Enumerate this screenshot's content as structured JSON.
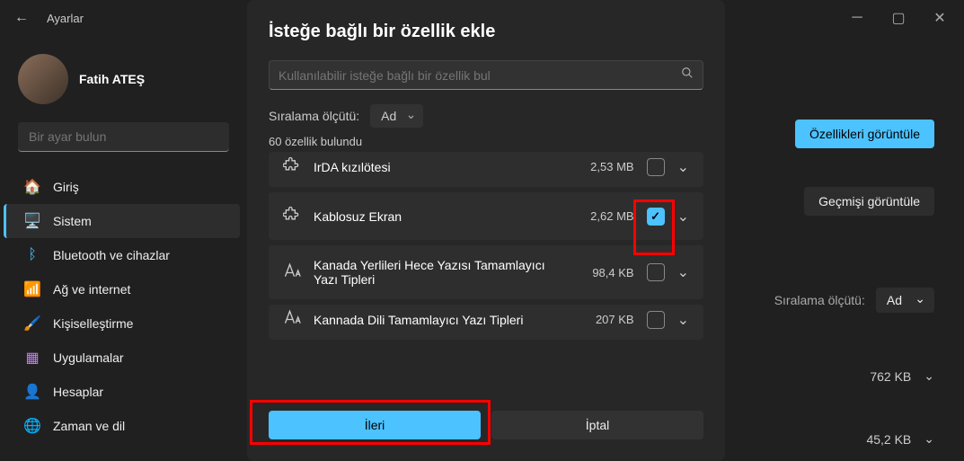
{
  "titlebar": {
    "back": "←",
    "title": "Ayarlar"
  },
  "profile": {
    "name": "Fatih ATEŞ"
  },
  "search": {
    "placeholder": "Bir ayar bulun"
  },
  "nav": [
    {
      "icon": "🏠",
      "label": "Giriş"
    },
    {
      "icon": "🖥️",
      "label": "Sistem"
    },
    {
      "icon": "ᛒ",
      "label": "Bluetooth ve cihazlar",
      "color": "#4cc2ff"
    },
    {
      "icon": "📶",
      "label": "Ağ ve internet",
      "color": "#4cc2ff"
    },
    {
      "icon": "🖌️",
      "label": "Kişiselleştirme"
    },
    {
      "icon": "▦",
      "label": "Uygulamalar",
      "color": "#c77dff"
    },
    {
      "icon": "👤",
      "label": "Hesaplar",
      "color": "#52b788"
    },
    {
      "icon": "🌐",
      "label": "Zaman ve dil"
    }
  ],
  "main": {
    "view_features": "Özellikleri görüntüle",
    "view_history": "Geçmişi görüntüle",
    "sort_label": "Sıralama ölçütü:",
    "sort_value": "Ad",
    "rows": [
      {
        "size": "762 KB"
      },
      {
        "size": "45,2 KB"
      }
    ]
  },
  "modal": {
    "title": "İsteğe bağlı bir özellik ekle",
    "search_placeholder": "Kullanılabilir isteğe bağlı bir özellik bul",
    "sort_label": "Sıralama ölçütü:",
    "sort_value": "Ad",
    "found": "60 özellik bulundu",
    "features": [
      {
        "name": "IrDA kızılötesi",
        "size": "2,53 MB",
        "checked": false,
        "icon": "puzzle",
        "truncated": true
      },
      {
        "name": "Kablosuz Ekran",
        "size": "2,62 MB",
        "checked": true,
        "icon": "puzzle"
      },
      {
        "name": "Kanada Yerlileri Hece Yazısı Tamamlayıcı Yazı Tipleri",
        "size": "98,4 KB",
        "checked": false,
        "icon": "font"
      },
      {
        "name": "Kannada Dili Tamamlayıcı Yazı Tipleri",
        "size": "207 KB",
        "checked": false,
        "icon": "font",
        "truncated": true
      }
    ],
    "next": "İleri",
    "cancel": "İptal"
  }
}
